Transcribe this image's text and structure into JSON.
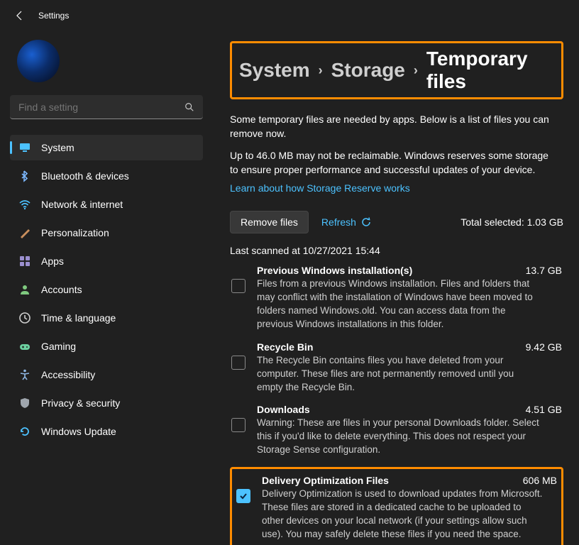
{
  "titlebar": {
    "title": "Settings"
  },
  "search": {
    "placeholder": "Find a setting"
  },
  "nav": {
    "items": [
      {
        "label": "System",
        "icon": "display",
        "color": "#4cc2ff",
        "selected": true
      },
      {
        "label": "Bluetooth & devices",
        "icon": "bluetooth",
        "color": "#7cb8ff"
      },
      {
        "label": "Network & internet",
        "icon": "wifi",
        "color": "#4cc2ff"
      },
      {
        "label": "Personalization",
        "icon": "brush",
        "color": "#c98f5d"
      },
      {
        "label": "Apps",
        "icon": "apps",
        "color": "#9b8fcf"
      },
      {
        "label": "Accounts",
        "icon": "person",
        "color": "#7fc97f"
      },
      {
        "label": "Time & language",
        "icon": "clock",
        "color": "#cfcfcf"
      },
      {
        "label": "Gaming",
        "icon": "gaming",
        "color": "#6bcf9f"
      },
      {
        "label": "Accessibility",
        "icon": "accessibility",
        "color": "#8fb8e6"
      },
      {
        "label": "Privacy & security",
        "icon": "shield",
        "color": "#9fa6ad"
      },
      {
        "label": "Windows Update",
        "icon": "update",
        "color": "#4cc2ff"
      }
    ]
  },
  "breadcrumb": {
    "parts": [
      "System",
      "Storage",
      "Temporary files"
    ]
  },
  "intro": "Some temporary files are needed by apps. Below is a list of files you can remove now.",
  "reserveText": "Up to 46.0 MB may not be reclaimable. Windows reserves some storage to ensure proper performance and successful updates of your device.",
  "reserveLink": "Learn about how Storage Reserve works",
  "actions": {
    "removeLabel": "Remove files",
    "refreshLabel": "Refresh",
    "totalSelectedLabel": "Total selected:",
    "totalSelectedValue": "1.03 GB"
  },
  "lastScanned": "Last scanned at 10/27/2021 15:44",
  "files": [
    {
      "title": "Previous Windows installation(s)",
      "size": "13.7 GB",
      "desc": "Files from a previous Windows installation.  Files and folders that may conflict with the installation of Windows have been moved to folders named Windows.old.  You can access data from the previous Windows installations in this folder.",
      "checked": false
    },
    {
      "title": "Recycle Bin",
      "size": "9.42 GB",
      "desc": "The Recycle Bin contains files you have deleted from your computer. These files are not permanently removed until you empty the Recycle Bin.",
      "checked": false
    },
    {
      "title": "Downloads",
      "size": "4.51 GB",
      "desc": "Warning: These are files in your personal Downloads folder. Select this if you'd like to delete everything. This does not respect your Storage Sense configuration.",
      "checked": false
    },
    {
      "title": "Delivery Optimization Files",
      "size": "606 MB",
      "desc": "Delivery Optimization is used to download updates from Microsoft. These files are stored in a dedicated cache to be uploaded to other devices on your local network (if your settings allow such use). You may safely delete these files if you need the space.",
      "checked": true,
      "highlight": true
    }
  ]
}
